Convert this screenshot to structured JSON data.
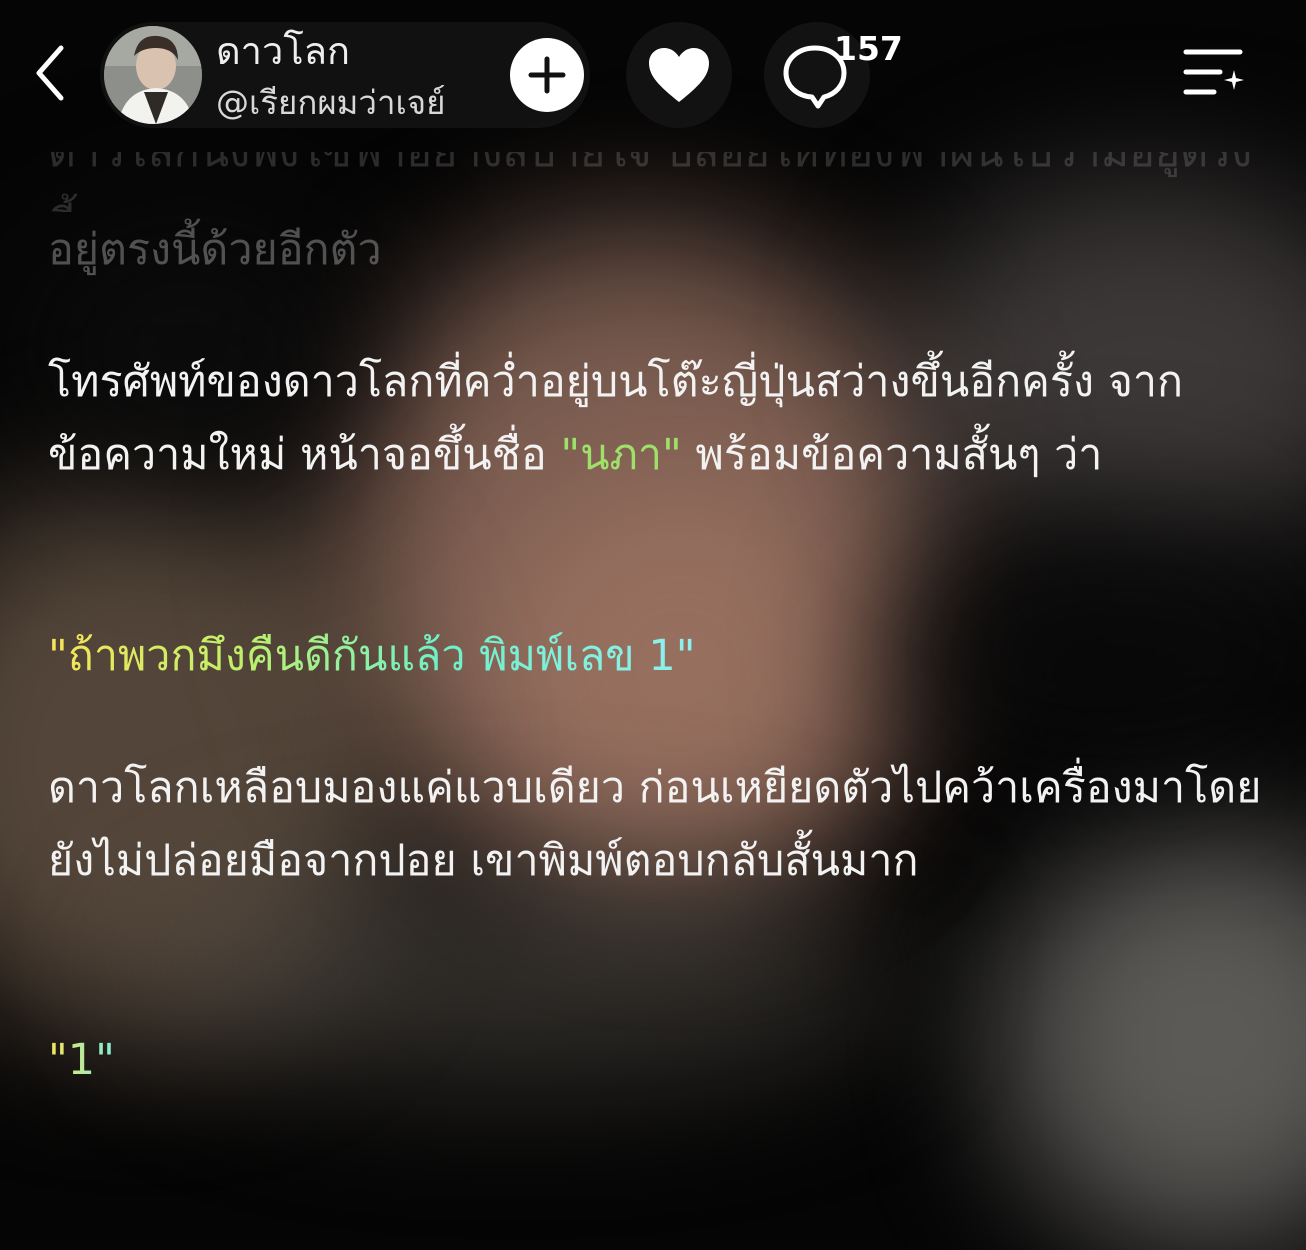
{
  "header": {
    "author_name": "ดาวโลก",
    "author_handle": "@เรียกผมว่าเจย์",
    "comment_count": "157"
  },
  "story": {
    "faded_cut_line": "ดาวโลกนั่งพิงโซฟาอย่างสบายใจ ปล่อยให้ท้องฟ้าฝันไปว่ามีอยู่ตรงนี้",
    "faded_line": "อยู่ตรงนี้ด้วยอีกตัว",
    "p1_before": "โทรศัพท์ของดาวโลกที่คว่ำอยู่บนโต๊ะญี่ปุ่นสว่างขึ้นอีกครั้ง จากข้อความใหม่ หน้าจอขึ้นชื่อ ",
    "p1_highlight": "\"นภา\"",
    "p1_after": " พร้อมข้อความสั้นๆ ว่า",
    "quote1": "\"ถ้าพวกมึงคืนดีกันแล้ว พิมพ์เลข 1\"",
    "p2": "ดาวโลกเหลือบมองแค่แวบเดียว ก่อนเหยียดตัวไปคว้าเครื่องมาโดยยังไม่ปล่อยมือจากปอย เขาพิมพ์ตอบกลับสั้นมาก",
    "quote2": "\"1\""
  },
  "colors": {
    "highlight_green": "#9fe06a",
    "quote_gradient_start": "#f7e45a",
    "quote_gradient_end": "#8ff0f0"
  },
  "icons": [
    "back-arrow-icon",
    "plus-icon",
    "heart-icon",
    "comment-bubble-icon",
    "list-menu-icon"
  ]
}
